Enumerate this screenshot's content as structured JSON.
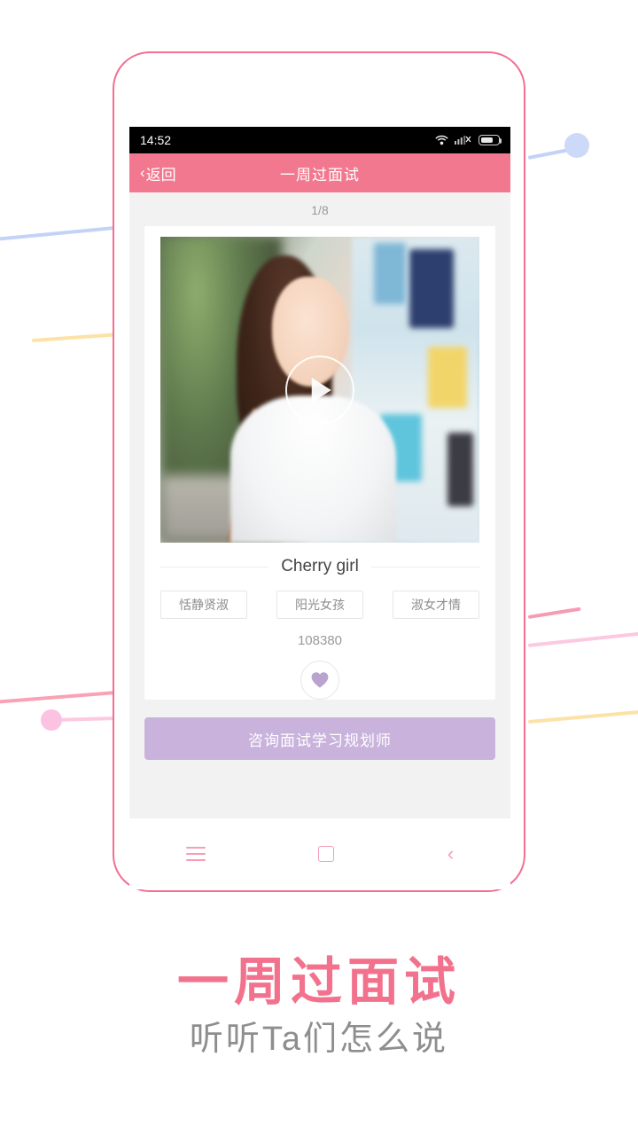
{
  "page": {
    "background_color": "#ffffff",
    "accent_pink": "#f2728d",
    "accent_purple": "#c9b3dc"
  },
  "phone": {
    "frame_color": "#f26f92",
    "camera_icon": "camera-pill",
    "speaker_icon": "speaker-pill"
  },
  "status_bar": {
    "time": "14:52",
    "wifi_icon": "wifi-icon",
    "signal_icon": "signal-bars-no-service-icon",
    "battery_icon": "battery-icon"
  },
  "nav_bar": {
    "back_chevron": "‹",
    "back_label": "返回",
    "title": "一周过面试",
    "background_color": "#f2788f"
  },
  "content": {
    "page_indicator": "1/8",
    "card": {
      "video": {
        "play_icon": "play-button-icon",
        "alt_name": "interview-video-thumbnail"
      },
      "name": "Cherry girl",
      "tags": [
        "恬静贤淑",
        "阳光女孩",
        "淑女才情"
      ],
      "count": "108380",
      "like_icon": "heart-icon"
    },
    "cta_label": "咨询面试学习规划师"
  },
  "soft_nav": {
    "menu_icon": "menu-icon",
    "home_icon": "home-square-icon",
    "back_icon": "back-chevron-icon"
  },
  "captions": {
    "headline": "一周过面试",
    "subhead": "听听Ta们怎么说"
  }
}
